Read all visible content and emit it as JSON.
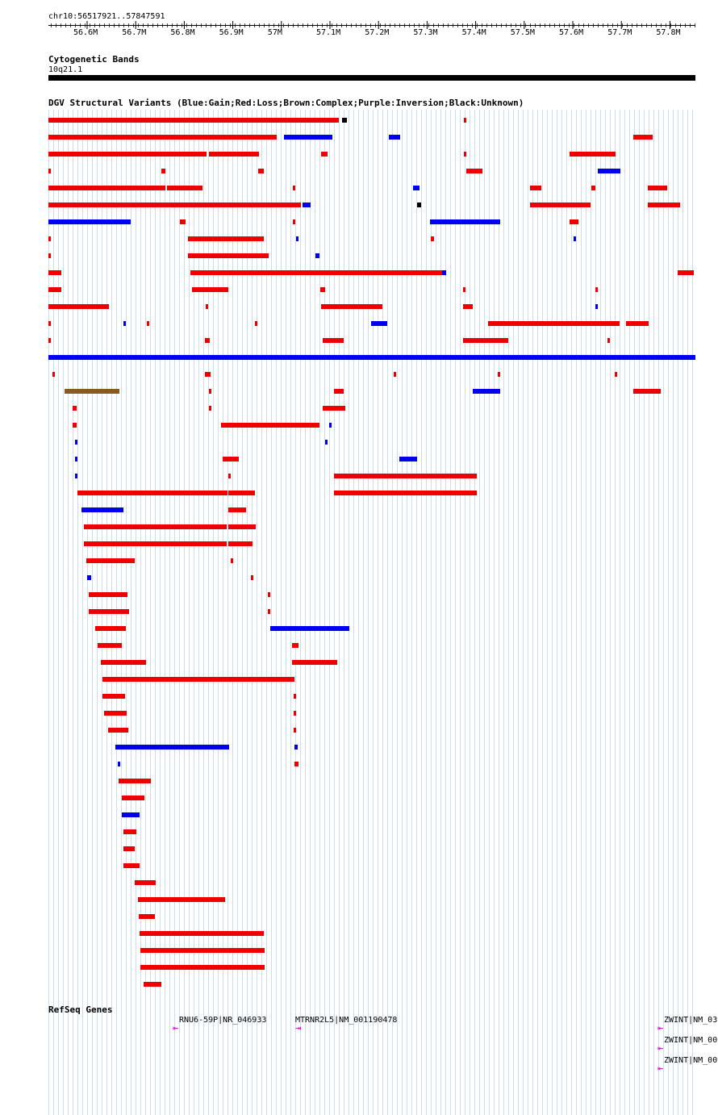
{
  "header": {
    "locus": "chr10:56517921..57847591",
    "ticks": [
      "56.6M",
      "56.7M",
      "56.8M",
      "56.9M",
      "57M",
      "57.1M",
      "57.2M",
      "57.3M",
      "57.4M",
      "57.5M",
      "57.6M",
      "57.7M",
      "57.8M"
    ]
  },
  "cytoband": {
    "title": "Cytogenetic Bands",
    "band": "10q21.1"
  },
  "dgv": {
    "title": "DGV Structural Variants (Blue:Gain;Red:Loss;Brown:Complex;Purple:Inversion;Black:Unknown)",
    "colors": {
      "gain": "#0000ee",
      "loss": "#ee0000",
      "complex": "#8a5a1a"
    }
  },
  "refseq": {
    "title": "RefSeq Genes",
    "genes": [
      "RNU6-59P|NR_046933",
      "MTRNR2L5|NM_001190478",
      "ZWINT|NM_03",
      "ZWINT|NM_00",
      "ZWINT|NM_00"
    ]
  }
}
